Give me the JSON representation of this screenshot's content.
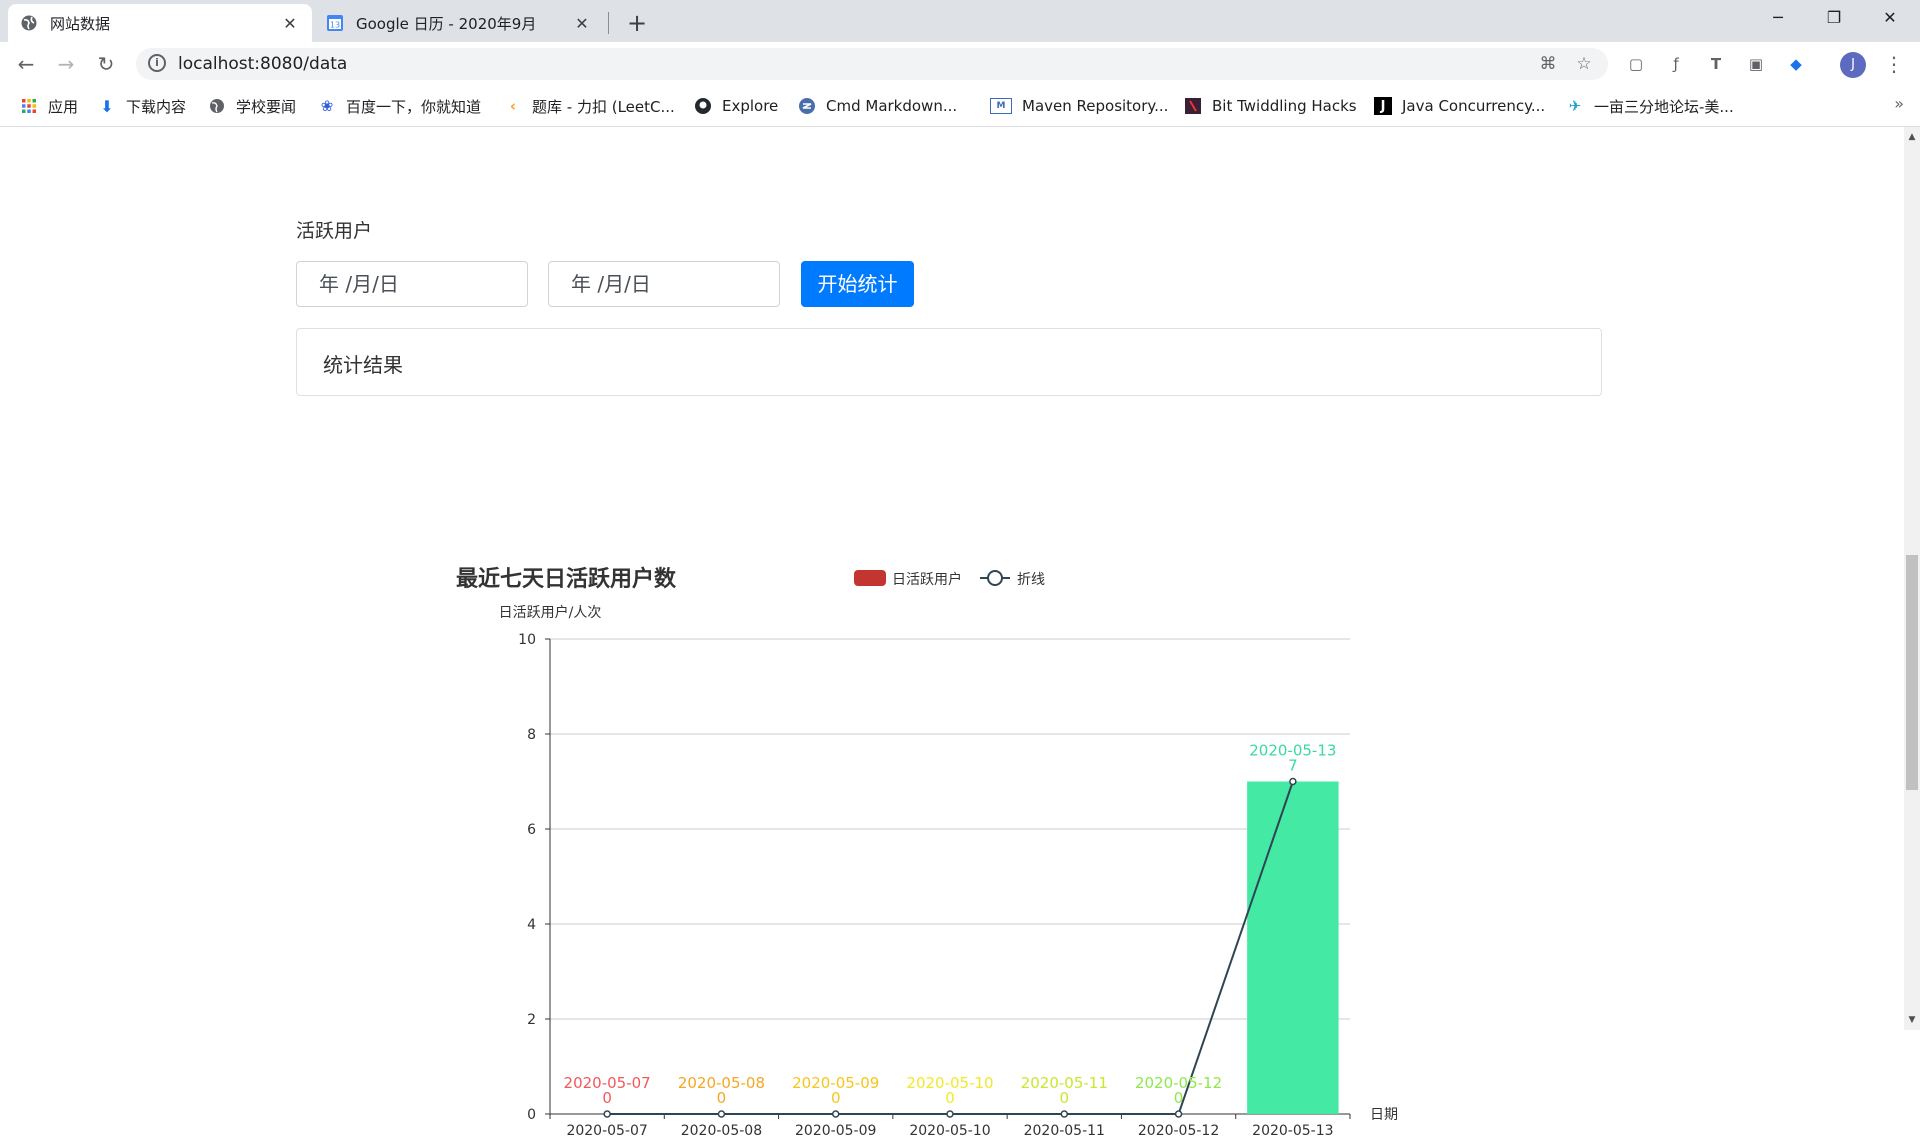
{
  "browser": {
    "tabs": [
      {
        "title": "网站数据",
        "active": true
      },
      {
        "title": "Google 日历 - 2020年9月",
        "active": false,
        "icon_text": "13"
      }
    ],
    "url": "localhost:8080/data",
    "profile_initial": "J",
    "bookmarks": [
      {
        "label": "应用",
        "icon": "apps-grid-icon"
      },
      {
        "label": "下载内容",
        "icon": "download-icon"
      },
      {
        "label": "学校要闻",
        "icon": "globe-icon"
      },
      {
        "label": "百度一下，你就知道",
        "icon": "baidu-paw-icon"
      },
      {
        "label": "题库 - 力扣 (LeetC...",
        "icon": "leetcode-icon"
      },
      {
        "label": "Explore",
        "icon": "github-icon"
      },
      {
        "label": "Cmd Markdown...",
        "icon": "cmd-markdown-icon"
      },
      {
        "label": "Maven Repository...",
        "icon": "maven-icon"
      },
      {
        "label": "Bit Twiddling Hacks",
        "icon": "bit-twiddling-icon"
      },
      {
        "label": "Java Concurrency...",
        "icon": "java-j-icon"
      },
      {
        "label": "一亩三分地论坛-美...",
        "icon": "forum-icon"
      }
    ]
  },
  "page": {
    "section_title": "活跃用户",
    "start_date_placeholder": "年 /月/日",
    "end_date_placeholder": "年 /月/日",
    "start_button": "开始统计",
    "result_label": "统计结果"
  },
  "colors": {
    "primary_button": "#007bff",
    "bar": "#44eaa4",
    "legend_bar": "#c23531",
    "line": "#2f4554"
  },
  "chart_data": {
    "type": "bar",
    "title": "最近七天日活跃用户数",
    "ylabel": "日活跃用户/人次",
    "xlabel": "日期",
    "ylim": [
      0,
      10
    ],
    "yticks": [
      0,
      2,
      4,
      6,
      8,
      10
    ],
    "categories": [
      "2020-05-07",
      "2020-05-08",
      "2020-05-09",
      "2020-05-10",
      "2020-05-11",
      "2020-05-12",
      "2020-05-13"
    ],
    "series": [
      {
        "name": "日活跃用户",
        "type": "bar",
        "values": [
          0,
          0,
          0,
          0,
          0,
          0,
          7
        ]
      },
      {
        "name": "折线",
        "type": "line",
        "values": [
          0,
          0,
          0,
          0,
          0,
          0,
          7
        ]
      }
    ],
    "label_colors": [
      "#f2585a",
      "#f5a623",
      "#f8c41c",
      "#f2e82a",
      "#c8e830",
      "#8ee84a",
      "#3bd9a2"
    ],
    "legend_position": "top-center"
  }
}
